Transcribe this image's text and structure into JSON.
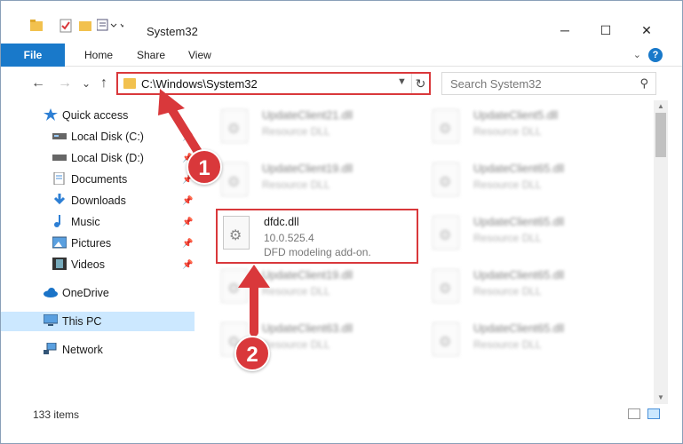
{
  "window": {
    "title": "System32",
    "controls": {
      "minimize": "─",
      "maximize": "☐",
      "close": "✕"
    }
  },
  "ribbon": {
    "tabs": [
      "File",
      "Home",
      "Share",
      "View"
    ],
    "collapse_glyph": "⌄",
    "help_glyph": "?"
  },
  "navigation": {
    "back": "←",
    "forward": "→",
    "recent": "⌄",
    "up": "↑",
    "address": "C:\\Windows\\System32",
    "search_placeholder": "Search System32"
  },
  "sidebar": {
    "items": [
      {
        "label": "Quick access",
        "icon": "star-icon",
        "pinned": false
      },
      {
        "label": "Local Disk (C:)",
        "icon": "drive-icon",
        "pinned": true
      },
      {
        "label": "Local Disk (D:)",
        "icon": "drive-icon",
        "pinned": true
      },
      {
        "label": "Documents",
        "icon": "documents-icon",
        "pinned": true
      },
      {
        "label": "Downloads",
        "icon": "download-icon",
        "pinned": true
      },
      {
        "label": "Music",
        "icon": "music-icon",
        "pinned": true
      },
      {
        "label": "Pictures",
        "icon": "pictures-icon",
        "pinned": true
      },
      {
        "label": "Videos",
        "icon": "videos-icon",
        "pinned": true
      },
      {
        "label": "OneDrive",
        "icon": "cloud-icon",
        "pinned": false
      },
      {
        "label": "This PC",
        "icon": "computer-icon",
        "pinned": false,
        "selected": true
      },
      {
        "label": "Network",
        "icon": "network-icon",
        "pinned": false
      }
    ]
  },
  "files": {
    "left": [
      {
        "name": "UpdateClient21.dll",
        "line2": "Resource DLL",
        "blurred": true
      },
      {
        "name": "UpdateClient19.dll",
        "line2": "Resource DLL",
        "blurred": true
      },
      {
        "name": "dfdc.dll",
        "line2": "10.0.525.4",
        "line3": "DFD modeling add-on.",
        "blurred": false,
        "highlighted": true
      },
      {
        "name": "UpdateClient19.dll",
        "line2": "Resource DLL",
        "blurred": true
      },
      {
        "name": "UpdateClient63.dll",
        "line2": "Resource DLL",
        "blurred": true
      }
    ],
    "right": [
      {
        "name": "UpdateClient5.dll",
        "line2": "Resource DLL",
        "blurred": true
      },
      {
        "name": "UpdateClient65.dll",
        "line2": "Resource DLL",
        "blurred": true
      },
      {
        "name": "UpdateClient65.dll",
        "line2": "Resource DLL",
        "blurred": true
      },
      {
        "name": "UpdateClient65.dll",
        "line2": "Resource DLL",
        "blurred": true
      },
      {
        "name": "UpdateClient65.dll",
        "line2": "Resource DLL",
        "blurred": true
      }
    ]
  },
  "status": {
    "item_count": "133 items"
  },
  "annotations": {
    "step1": "1",
    "step2": "2",
    "accent": "#d9383b"
  },
  "colors": {
    "file_tab": "#1979ca",
    "selected_nav": "#cce8ff",
    "folder": "#f2c14e"
  }
}
